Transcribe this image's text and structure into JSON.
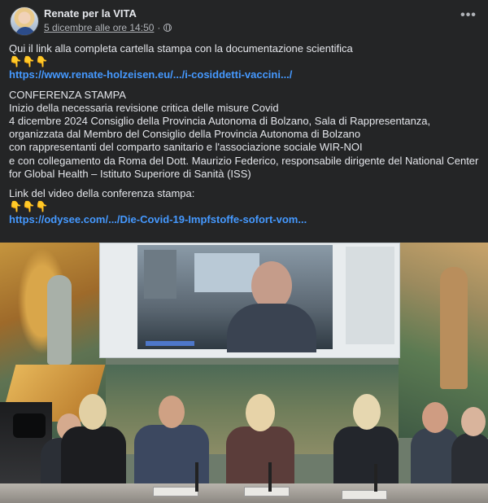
{
  "post": {
    "author": "Renate per la VITA",
    "timestamp": "5 dicembre alle ore 14:50",
    "more_options": "•••",
    "lines": {
      "l1": "Qui il link alla completa cartella stampa con la documentazione scientifica",
      "e1": "👇👇👇",
      "link1": "https://www.renate-holzeisen.eu/.../i-cosiddetti-vaccini.../",
      "l2": "CONFERENZA STAMPA",
      "l3": "Inizio della necessaria revisione critica delle misure Covid",
      "l4": "4 dicembre 2024 Consiglio della Provincia Autonoma di Bolzano, Sala di Rappresentanza,",
      "l5": "organizzata dal Membro del Consiglio della Provincia Autonoma di Bolzano",
      "l6": "con rappresentanti del comparto sanitario e l'associazione sociale WIR-NOI",
      "l7": "e con collegamento da Roma del Dott. Maurizio Federico, responsabile dirigente del National Center",
      "l8": "for Global Health – Istituto Superiore di Sanità (ISS)",
      "l9": "Link del video della conferenza stampa:",
      "e2": "👇👇👇",
      "link2": "https://odysee.com/.../Die-Covid-19-Impfstoffe-sofort-vom..."
    }
  },
  "colors": {
    "background": "#242526",
    "text": "#e4e6eb",
    "secondary_text": "#b0b3b8",
    "link": "#4599ff"
  },
  "icons": {
    "privacy": "globe-icon",
    "menu": "more-options-icon"
  }
}
